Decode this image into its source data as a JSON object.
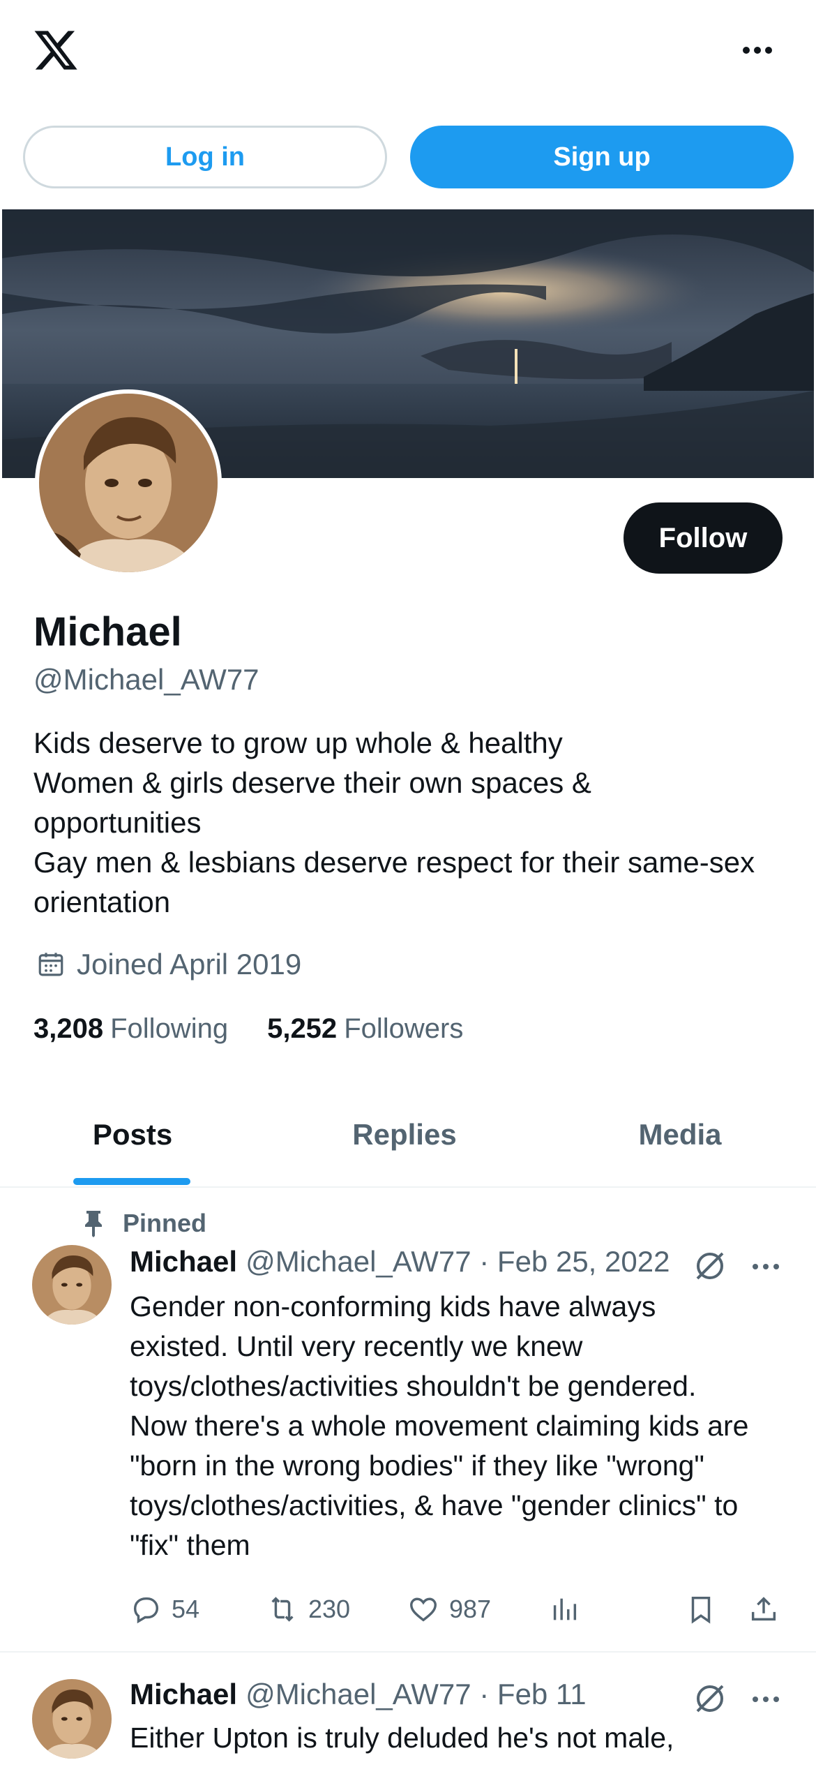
{
  "topbar": {
    "logo_icon": "x-logo-icon",
    "more_icon": "more-horizontal-icon"
  },
  "auth": {
    "login_label": "Log in",
    "signup_label": "Sign up"
  },
  "profile": {
    "name": "Michael",
    "handle": "@Michael_AW77",
    "follow_label": "Follow",
    "bio_lines": [
      "Kids deserve to grow up whole & healthy",
      "Women & girls deserve their own spaces &",
      "opportunities",
      "Gay men & lesbians deserve respect for their same-sex",
      "orientation"
    ],
    "joined": "Joined April 2019",
    "following_count": "3,208",
    "following_label": "Following",
    "followers_count": "5,252",
    "followers_label": "Followers"
  },
  "tabs": [
    {
      "label": "Posts",
      "active": true
    },
    {
      "label": "Replies",
      "active": false
    },
    {
      "label": "Media",
      "active": false
    }
  ],
  "posts": [
    {
      "pinned_label": "Pinned",
      "name": "Michael",
      "handle_date": "@Michael_AW77 · Feb 25, 2022",
      "text_lines": [
        "Gender non-conforming kids have always",
        "existed. Until very recently we knew",
        "toys/clothes/activities shouldn't be gendered.",
        "Now there's a whole movement claiming kids are",
        "\"born in the wrong bodies\" if they like \"wrong\"",
        "toys/clothes/activities, & have \"gender clinics\" to",
        "\"fix\" them"
      ],
      "replies": "54",
      "reposts": "230",
      "likes": "987"
    },
    {
      "name": "Michael",
      "handle_date": "@Michael_AW77 · Feb 11",
      "text_lines": [
        "Either Upton is truly deluded he's not male,"
      ]
    }
  ],
  "colors": {
    "accent": "#1d9bf0",
    "text": "#0f1419",
    "secondary": "#536471",
    "border": "#eff3f4"
  }
}
